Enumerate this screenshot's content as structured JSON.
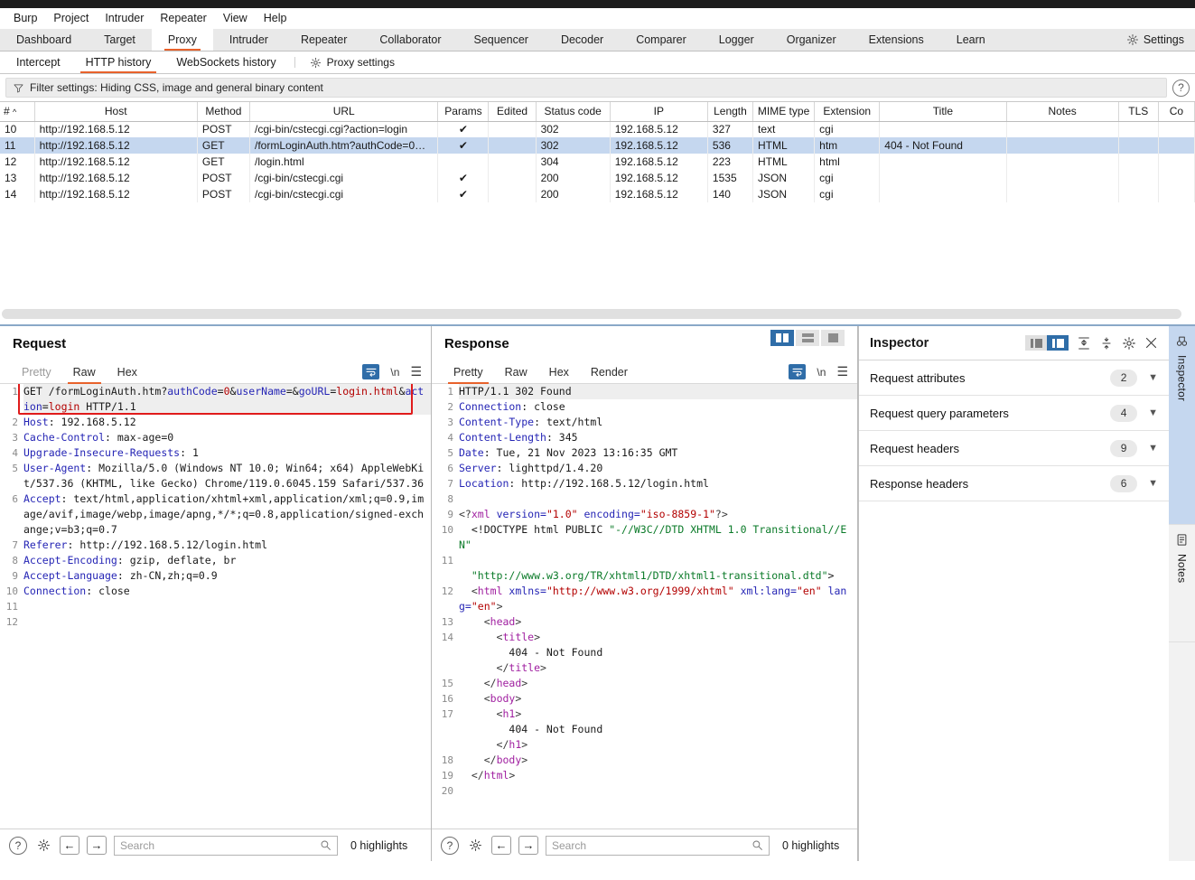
{
  "menubar": [
    "Burp",
    "Project",
    "Intruder",
    "Repeater",
    "View",
    "Help"
  ],
  "main_tabs": [
    {
      "label": "Dashboard",
      "selected": false
    },
    {
      "label": "Target",
      "selected": false
    },
    {
      "label": "Proxy",
      "selected": true
    },
    {
      "label": "Intruder",
      "selected": false
    },
    {
      "label": "Repeater",
      "selected": false
    },
    {
      "label": "Collaborator",
      "selected": false
    },
    {
      "label": "Sequencer",
      "selected": false
    },
    {
      "label": "Decoder",
      "selected": false
    },
    {
      "label": "Comparer",
      "selected": false
    },
    {
      "label": "Logger",
      "selected": false
    },
    {
      "label": "Organizer",
      "selected": false
    },
    {
      "label": "Extensions",
      "selected": false
    },
    {
      "label": "Learn",
      "selected": false
    }
  ],
  "settings_button": "Settings",
  "sub_tabs": [
    {
      "label": "Intercept",
      "selected": false
    },
    {
      "label": "HTTP history",
      "selected": true
    },
    {
      "label": "WebSockets history",
      "selected": false
    }
  ],
  "proxy_settings_label": "Proxy settings",
  "filter": {
    "text": "Filter settings: Hiding CSS, image and general binary content",
    "help": "?"
  },
  "history": {
    "columns": [
      "#",
      "Host",
      "Method",
      "URL",
      "Params",
      "Edited",
      "Status code",
      "IP",
      "Length",
      "MIME type",
      "Extension",
      "Title",
      "Notes",
      "TLS",
      "Co"
    ],
    "sort_indicator": "^",
    "rows": [
      {
        "num": "10",
        "host": "http://192.168.5.12",
        "method": "POST",
        "url": "/cgi-bin/cstecgi.cgi?action=login",
        "params": "✔",
        "edited": "",
        "status": "302",
        "ip": "192.168.5.12",
        "length": "327",
        "mime": "text",
        "ext": "cgi",
        "title": "",
        "notes": "",
        "tls": "",
        "co": "",
        "selected": false
      },
      {
        "num": "11",
        "host": "http://192.168.5.12",
        "method": "GET",
        "url": "/formLoginAuth.htm?authCode=0…",
        "params": "✔",
        "edited": "",
        "status": "302",
        "ip": "192.168.5.12",
        "length": "536",
        "mime": "HTML",
        "ext": "htm",
        "title": "404 - Not Found",
        "notes": "",
        "tls": "",
        "co": "",
        "selected": true
      },
      {
        "num": "12",
        "host": "http://192.168.5.12",
        "method": "GET",
        "url": "/login.html",
        "params": "",
        "edited": "",
        "status": "304",
        "ip": "192.168.5.12",
        "length": "223",
        "mime": "HTML",
        "ext": "html",
        "title": "",
        "notes": "",
        "tls": "",
        "co": "",
        "selected": false
      },
      {
        "num": "13",
        "host": "http://192.168.5.12",
        "method": "POST",
        "url": "/cgi-bin/cstecgi.cgi",
        "params": "✔",
        "edited": "",
        "status": "200",
        "ip": "192.168.5.12",
        "length": "1535",
        "mime": "JSON",
        "ext": "cgi",
        "title": "",
        "notes": "",
        "tls": "",
        "co": "",
        "selected": false
      },
      {
        "num": "14",
        "host": "http://192.168.5.12",
        "method": "POST",
        "url": "/cgi-bin/cstecgi.cgi",
        "params": "✔",
        "edited": "",
        "status": "200",
        "ip": "192.168.5.12",
        "length": "140",
        "mime": "JSON",
        "ext": "cgi",
        "title": "",
        "notes": "",
        "tls": "",
        "co": "",
        "selected": false
      }
    ]
  },
  "request": {
    "title": "Request",
    "tabs": [
      {
        "label": "Pretty",
        "selected": false,
        "dim": true
      },
      {
        "label": "Raw",
        "selected": true,
        "dim": false
      },
      {
        "label": "Hex",
        "selected": false,
        "dim": false
      }
    ],
    "newline_label": "\\n",
    "lines": [
      {
        "n": "1",
        "parts": [
          {
            "t": "GET /formLoginAuth.htm?",
            "c": "kw"
          },
          {
            "t": "authCode",
            "c": "blue"
          },
          {
            "t": "=",
            "c": "kw"
          },
          {
            "t": "0",
            "c": "red"
          },
          {
            "t": "&",
            "c": "kw"
          },
          {
            "t": "userName",
            "c": "blue"
          },
          {
            "t": "=&",
            "c": "kw"
          },
          {
            "t": "goURL",
            "c": "blue"
          },
          {
            "t": "=",
            "c": "kw"
          },
          {
            "t": "login.html",
            "c": "red"
          },
          {
            "t": "&",
            "c": "kw"
          },
          {
            "t": "action",
            "c": "blue"
          },
          {
            "t": "=",
            "c": "kw"
          },
          {
            "t": "login",
            "c": "red"
          },
          {
            "t": " HTTP/1.1",
            "c": "kw"
          }
        ]
      },
      {
        "n": "2",
        "parts": [
          {
            "t": "Host",
            "c": "hdrname"
          },
          {
            "t": ": 192.168.5.12",
            "c": "kw"
          }
        ]
      },
      {
        "n": "3",
        "parts": [
          {
            "t": "Cache-Control",
            "c": "hdrname"
          },
          {
            "t": ": max-age=0",
            "c": "kw"
          }
        ]
      },
      {
        "n": "4",
        "parts": [
          {
            "t": "Upgrade-Insecure-Requests",
            "c": "hdrname"
          },
          {
            "t": ": 1",
            "c": "kw"
          }
        ]
      },
      {
        "n": "5",
        "parts": [
          {
            "t": "User-Agent",
            "c": "hdrname"
          },
          {
            "t": ": Mozilla/5.0 (Windows NT 10.0; Win64; x64) AppleWebKit/537.36 (KHTML, like Gecko) Chrome/119.0.6045.159 Safari/537.36",
            "c": "kw"
          }
        ]
      },
      {
        "n": "6",
        "parts": [
          {
            "t": "Accept",
            "c": "hdrname"
          },
          {
            "t": ": text/html,application/xhtml+xml,application/xml;q=0.9,image/avif,image/webp,image/apng,*/*;q=0.8,application/signed-exchange;v=b3;q=0.7",
            "c": "kw"
          }
        ]
      },
      {
        "n": "7",
        "parts": [
          {
            "t": "Referer",
            "c": "hdrname"
          },
          {
            "t": ": http://192.168.5.12/login.html",
            "c": "kw"
          }
        ]
      },
      {
        "n": "8",
        "parts": [
          {
            "t": "Accept-Encoding",
            "c": "hdrname"
          },
          {
            "t": ": gzip, deflate, br",
            "c": "kw"
          }
        ]
      },
      {
        "n": "9",
        "parts": [
          {
            "t": "Accept-Language",
            "c": "hdrname"
          },
          {
            "t": ": zh-CN,zh;q=0.9",
            "c": "kw"
          }
        ]
      },
      {
        "n": "10",
        "parts": [
          {
            "t": "Connection",
            "c": "hdrname"
          },
          {
            "t": ": close",
            "c": "kw"
          }
        ]
      },
      {
        "n": "11",
        "parts": []
      },
      {
        "n": "12",
        "parts": []
      }
    ],
    "footer": {
      "search_placeholder": "Search",
      "search_value": "",
      "highlights": "0 highlights"
    }
  },
  "response": {
    "title": "Response",
    "tabs": [
      {
        "label": "Pretty",
        "selected": true,
        "dim": false
      },
      {
        "label": "Raw",
        "selected": false,
        "dim": false
      },
      {
        "label": "Hex",
        "selected": false,
        "dim": false
      },
      {
        "label": "Render",
        "selected": false,
        "dim": false
      }
    ],
    "newline_label": "\\n",
    "layout_buttons": [
      "split-view",
      "stacked-view",
      "single-view"
    ],
    "lines": [
      {
        "n": "1",
        "parts": [
          {
            "t": "HTTP/1.1 302 Found",
            "c": "kw"
          }
        ]
      },
      {
        "n": "2",
        "parts": [
          {
            "t": "Connection",
            "c": "hdrname"
          },
          {
            "t": ": close",
            "c": "kw"
          }
        ]
      },
      {
        "n": "3",
        "parts": [
          {
            "t": "Content-Type",
            "c": "hdrname"
          },
          {
            "t": ": text/html",
            "c": "kw"
          }
        ]
      },
      {
        "n": "4",
        "parts": [
          {
            "t": "Content-Length",
            "c": "hdrname"
          },
          {
            "t": ": 345",
            "c": "kw"
          }
        ]
      },
      {
        "n": "5",
        "parts": [
          {
            "t": "Date",
            "c": "hdrname"
          },
          {
            "t": ": Tue, 21 Nov 2023 13:16:35 GMT",
            "c": "kw"
          }
        ]
      },
      {
        "n": "6",
        "parts": [
          {
            "t": "Server",
            "c": "hdrname"
          },
          {
            "t": ": lighttpd/1.4.20",
            "c": "kw"
          }
        ]
      },
      {
        "n": "7",
        "parts": [
          {
            "t": "Location",
            "c": "hdrname"
          },
          {
            "t": ": http://192.168.5.12/login.html",
            "c": "kw"
          }
        ]
      },
      {
        "n": "8",
        "parts": []
      },
      {
        "n": "9",
        "parts": [
          {
            "t": "<?",
            "c": "tagbr"
          },
          {
            "t": "xml",
            "c": "purple"
          },
          {
            "t": " version=",
            "c": "blue"
          },
          {
            "t": "\"1.0\"",
            "c": "red"
          },
          {
            "t": " encoding=",
            "c": "blue"
          },
          {
            "t": "\"iso-8859-1\"",
            "c": "red"
          },
          {
            "t": "?>",
            "c": "tagbr"
          }
        ]
      },
      {
        "n": "10",
        "parts": [
          {
            "t": "  <!DOCTYPE html PUBLIC ",
            "c": "kw"
          },
          {
            "t": "\"-//W3C//DTD XHTML 1.0 Transitional//EN\"",
            "c": "green"
          }
        ]
      },
      {
        "n": "11",
        "parts": [
          {
            "t": "  ",
            "c": "kw"
          },
          {
            "t": "\"http://www.w3.org/TR/xhtml1/DTD/xhtml1-transitional.dtd\"",
            "c": "green"
          },
          {
            "t": ">",
            "c": "kw"
          }
        ]
      },
      {
        "n": "12",
        "parts": [
          {
            "t": "  <",
            "c": "tagbr"
          },
          {
            "t": "html",
            "c": "purple"
          },
          {
            "t": " xmlns=",
            "c": "blue"
          },
          {
            "t": "\"http://www.w3.org/1999/xhtml\"",
            "c": "red"
          },
          {
            "t": " xml:lang=",
            "c": "blue"
          },
          {
            "t": "\"en\"",
            "c": "red"
          },
          {
            "t": " lang=",
            "c": "blue"
          },
          {
            "t": "\"en\"",
            "c": "red"
          },
          {
            "t": ">",
            "c": "tagbr"
          }
        ]
      },
      {
        "n": "13",
        "parts": [
          {
            "t": "    <",
            "c": "tagbr"
          },
          {
            "t": "head",
            "c": "purple"
          },
          {
            "t": ">",
            "c": "tagbr"
          }
        ]
      },
      {
        "n": "14",
        "parts": [
          {
            "t": "      <",
            "c": "tagbr"
          },
          {
            "t": "title",
            "c": "purple"
          },
          {
            "t": ">",
            "c": "tagbr"
          },
          {
            "t": "\n        404 - Not Found\n      ",
            "c": "kw"
          },
          {
            "t": "</",
            "c": "tagbr"
          },
          {
            "t": "title",
            "c": "purple"
          },
          {
            "t": ">",
            "c": "tagbr"
          }
        ]
      },
      {
        "n": "15",
        "parts": [
          {
            "t": "    </",
            "c": "tagbr"
          },
          {
            "t": "head",
            "c": "purple"
          },
          {
            "t": ">",
            "c": "tagbr"
          }
        ]
      },
      {
        "n": "16",
        "parts": [
          {
            "t": "    <",
            "c": "tagbr"
          },
          {
            "t": "body",
            "c": "purple"
          },
          {
            "t": ">",
            "c": "tagbr"
          }
        ]
      },
      {
        "n": "17",
        "parts": [
          {
            "t": "      <",
            "c": "tagbr"
          },
          {
            "t": "h1",
            "c": "purple"
          },
          {
            "t": ">",
            "c": "tagbr"
          },
          {
            "t": "\n        404 - Not Found\n      ",
            "c": "kw"
          },
          {
            "t": "</",
            "c": "tagbr"
          },
          {
            "t": "h1",
            "c": "purple"
          },
          {
            "t": ">",
            "c": "tagbr"
          }
        ]
      },
      {
        "n": "18",
        "parts": [
          {
            "t": "    </",
            "c": "tagbr"
          },
          {
            "t": "body",
            "c": "purple"
          },
          {
            "t": ">",
            "c": "tagbr"
          }
        ]
      },
      {
        "n": "19",
        "parts": [
          {
            "t": "  </",
            "c": "tagbr"
          },
          {
            "t": "html",
            "c": "purple"
          },
          {
            "t": ">",
            "c": "tagbr"
          }
        ]
      },
      {
        "n": "20",
        "parts": []
      }
    ],
    "footer": {
      "search_placeholder": "Search",
      "search_value": "",
      "highlights": "0 highlights"
    }
  },
  "inspector": {
    "title": "Inspector",
    "sections": [
      {
        "label": "Request attributes",
        "count": "2"
      },
      {
        "label": "Request query parameters",
        "count": "4"
      },
      {
        "label": "Request headers",
        "count": "9"
      },
      {
        "label": "Response headers",
        "count": "6"
      }
    ],
    "side_tabs": [
      {
        "label": "Inspector",
        "selected": true
      },
      {
        "label": "Notes",
        "selected": false
      }
    ]
  },
  "colors": {
    "accent": "#e8622c",
    "selection": "#c5d7ef",
    "toggle_active": "#2f6da8",
    "highlight_border": "#e01b1b"
  }
}
